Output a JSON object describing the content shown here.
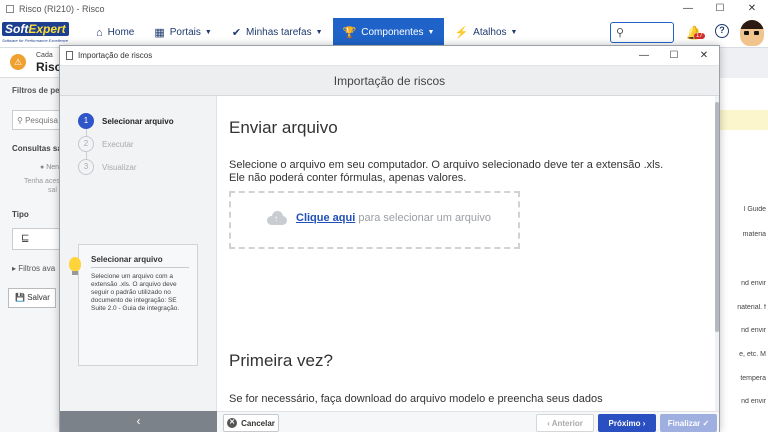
{
  "window": {
    "title": "Risco (RI210) - Risco",
    "min": "—",
    "max": "☐",
    "close": "✕"
  },
  "nav": {
    "logo_main": "Soft",
    "logo_accent": "Expert",
    "logo_tagline": "Software for Performance Excellence",
    "items": [
      {
        "label": "Home",
        "icon": "⌂"
      },
      {
        "label": "Portais",
        "icon": "▦"
      },
      {
        "label": "Minhas tarefas",
        "icon": "✔"
      },
      {
        "label": "Componentes",
        "icon": "🏆"
      },
      {
        "label": "Atalhos",
        "icon": "⚡"
      }
    ],
    "notifications_count": "17"
  },
  "background": {
    "header_small": "Cada",
    "header_title": "Risco",
    "filter_title": "Filtros de pes",
    "search_placeholder": "Pesquisa",
    "saved_queries": "Consultas sal",
    "none": "Nen",
    "hint": "Tenha aces",
    "hint2": "sal",
    "type_label": "Tipo",
    "type_btn": "⊑",
    "advanced_filters": "Filtros ava",
    "save": "Salvar",
    "right_rows": [
      "l Guide",
      "materia",
      "nd envir",
      "naterial. f",
      "nd envir",
      "e, etc. M",
      "tempera",
      "nd envir"
    ]
  },
  "modal": {
    "window_title": "Importação de riscos",
    "header": "Importação de riscos",
    "steps": [
      {
        "num": "1",
        "label": "Selecionar arquivo"
      },
      {
        "num": "2",
        "label": "Executar"
      },
      {
        "num": "3",
        "label": "Visualizar"
      }
    ],
    "tip": {
      "title": "Selecionar arquivo",
      "body": "Selecione um arquivo com a extensão .xls. O arquivo deve seguir o padrão utilizado no documento de integração: SE Suite 2.0 - Guia de integração."
    },
    "collapse": "‹",
    "upload": {
      "heading": "Enviar arquivo",
      "line1": "Selecione o arquivo em seu computador. O arquivo selecionado deve ter a extensão .xls.",
      "line2": "Ele não poderá conter fórmulas, apenas valores.",
      "link": "Clique aqui",
      "rest": " para selecionar um arquivo"
    },
    "first_time": {
      "heading": "Primeira vez?",
      "line": "Se for necessário, faça download do arquivo modelo e preencha seus dados"
    },
    "buttons": {
      "cancel": "Cancelar",
      "prev": "‹  Anterior",
      "next": "Próximo  ›",
      "finish": "Finalizar ✓"
    }
  }
}
